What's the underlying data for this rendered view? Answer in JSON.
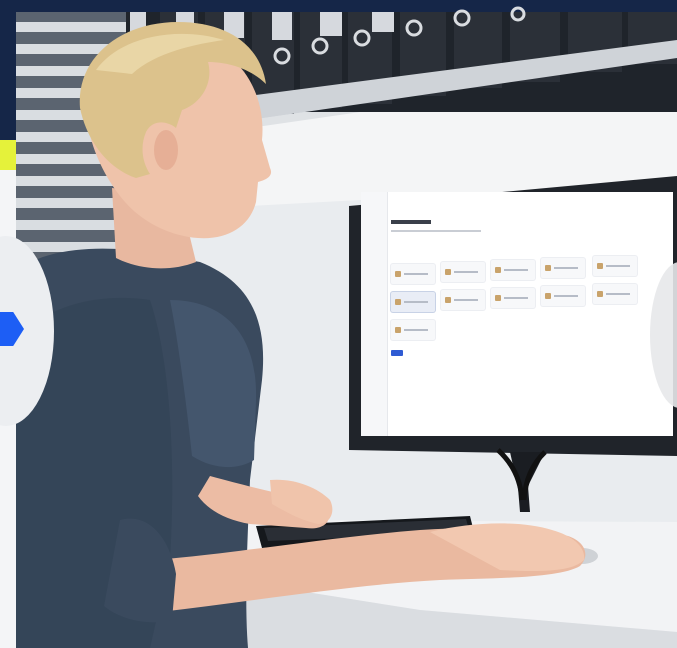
{
  "scene": {
    "icons": {
      "left_badge_arrow": "chevron-right-icon"
    },
    "colors": {
      "navy": "#152648",
      "accent_yellow": "#e5f23a",
      "accent_blue": "#1d5ef5",
      "scrub_top": "#3a4a5e",
      "wall": "#e9ecef"
    }
  }
}
